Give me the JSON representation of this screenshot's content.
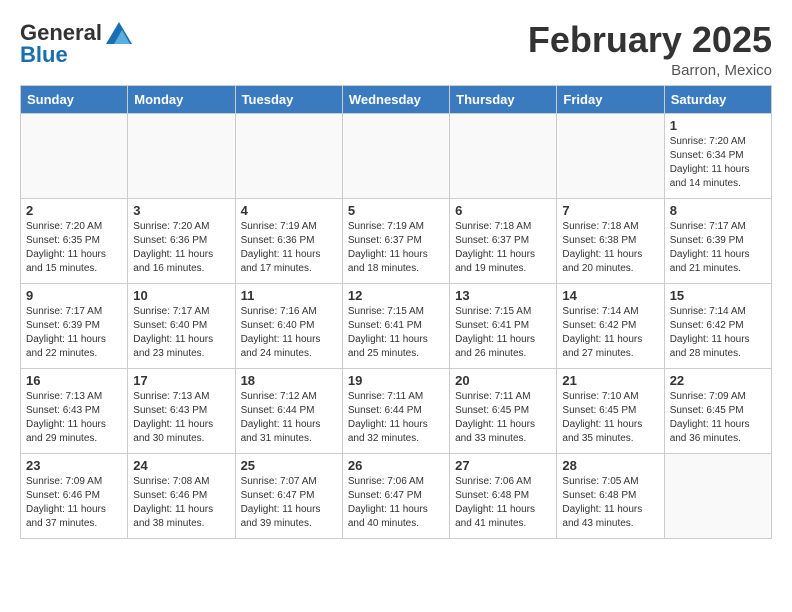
{
  "header": {
    "logo_line1": "General",
    "logo_line2": "Blue",
    "month_title": "February 2025",
    "location": "Barron, Mexico"
  },
  "weekdays": [
    "Sunday",
    "Monday",
    "Tuesday",
    "Wednesday",
    "Thursday",
    "Friday",
    "Saturday"
  ],
  "weeks": [
    [
      {
        "day": "",
        "info": ""
      },
      {
        "day": "",
        "info": ""
      },
      {
        "day": "",
        "info": ""
      },
      {
        "day": "",
        "info": ""
      },
      {
        "day": "",
        "info": ""
      },
      {
        "day": "",
        "info": ""
      },
      {
        "day": "1",
        "info": "Sunrise: 7:20 AM\nSunset: 6:34 PM\nDaylight: 11 hours\nand 14 minutes."
      }
    ],
    [
      {
        "day": "2",
        "info": "Sunrise: 7:20 AM\nSunset: 6:35 PM\nDaylight: 11 hours\nand 15 minutes."
      },
      {
        "day": "3",
        "info": "Sunrise: 7:20 AM\nSunset: 6:36 PM\nDaylight: 11 hours\nand 16 minutes."
      },
      {
        "day": "4",
        "info": "Sunrise: 7:19 AM\nSunset: 6:36 PM\nDaylight: 11 hours\nand 17 minutes."
      },
      {
        "day": "5",
        "info": "Sunrise: 7:19 AM\nSunset: 6:37 PM\nDaylight: 11 hours\nand 18 minutes."
      },
      {
        "day": "6",
        "info": "Sunrise: 7:18 AM\nSunset: 6:37 PM\nDaylight: 11 hours\nand 19 minutes."
      },
      {
        "day": "7",
        "info": "Sunrise: 7:18 AM\nSunset: 6:38 PM\nDaylight: 11 hours\nand 20 minutes."
      },
      {
        "day": "8",
        "info": "Sunrise: 7:17 AM\nSunset: 6:39 PM\nDaylight: 11 hours\nand 21 minutes."
      }
    ],
    [
      {
        "day": "9",
        "info": "Sunrise: 7:17 AM\nSunset: 6:39 PM\nDaylight: 11 hours\nand 22 minutes."
      },
      {
        "day": "10",
        "info": "Sunrise: 7:17 AM\nSunset: 6:40 PM\nDaylight: 11 hours\nand 23 minutes."
      },
      {
        "day": "11",
        "info": "Sunrise: 7:16 AM\nSunset: 6:40 PM\nDaylight: 11 hours\nand 24 minutes."
      },
      {
        "day": "12",
        "info": "Sunrise: 7:15 AM\nSunset: 6:41 PM\nDaylight: 11 hours\nand 25 minutes."
      },
      {
        "day": "13",
        "info": "Sunrise: 7:15 AM\nSunset: 6:41 PM\nDaylight: 11 hours\nand 26 minutes."
      },
      {
        "day": "14",
        "info": "Sunrise: 7:14 AM\nSunset: 6:42 PM\nDaylight: 11 hours\nand 27 minutes."
      },
      {
        "day": "15",
        "info": "Sunrise: 7:14 AM\nSunset: 6:42 PM\nDaylight: 11 hours\nand 28 minutes."
      }
    ],
    [
      {
        "day": "16",
        "info": "Sunrise: 7:13 AM\nSunset: 6:43 PM\nDaylight: 11 hours\nand 29 minutes."
      },
      {
        "day": "17",
        "info": "Sunrise: 7:13 AM\nSunset: 6:43 PM\nDaylight: 11 hours\nand 30 minutes."
      },
      {
        "day": "18",
        "info": "Sunrise: 7:12 AM\nSunset: 6:44 PM\nDaylight: 11 hours\nand 31 minutes."
      },
      {
        "day": "19",
        "info": "Sunrise: 7:11 AM\nSunset: 6:44 PM\nDaylight: 11 hours\nand 32 minutes."
      },
      {
        "day": "20",
        "info": "Sunrise: 7:11 AM\nSunset: 6:45 PM\nDaylight: 11 hours\nand 33 minutes."
      },
      {
        "day": "21",
        "info": "Sunrise: 7:10 AM\nSunset: 6:45 PM\nDaylight: 11 hours\nand 35 minutes."
      },
      {
        "day": "22",
        "info": "Sunrise: 7:09 AM\nSunset: 6:45 PM\nDaylight: 11 hours\nand 36 minutes."
      }
    ],
    [
      {
        "day": "23",
        "info": "Sunrise: 7:09 AM\nSunset: 6:46 PM\nDaylight: 11 hours\nand 37 minutes."
      },
      {
        "day": "24",
        "info": "Sunrise: 7:08 AM\nSunset: 6:46 PM\nDaylight: 11 hours\nand 38 minutes."
      },
      {
        "day": "25",
        "info": "Sunrise: 7:07 AM\nSunset: 6:47 PM\nDaylight: 11 hours\nand 39 minutes."
      },
      {
        "day": "26",
        "info": "Sunrise: 7:06 AM\nSunset: 6:47 PM\nDaylight: 11 hours\nand 40 minutes."
      },
      {
        "day": "27",
        "info": "Sunrise: 7:06 AM\nSunset: 6:48 PM\nDaylight: 11 hours\nand 41 minutes."
      },
      {
        "day": "28",
        "info": "Sunrise: 7:05 AM\nSunset: 6:48 PM\nDaylight: 11 hours\nand 43 minutes."
      },
      {
        "day": "",
        "info": ""
      }
    ]
  ]
}
